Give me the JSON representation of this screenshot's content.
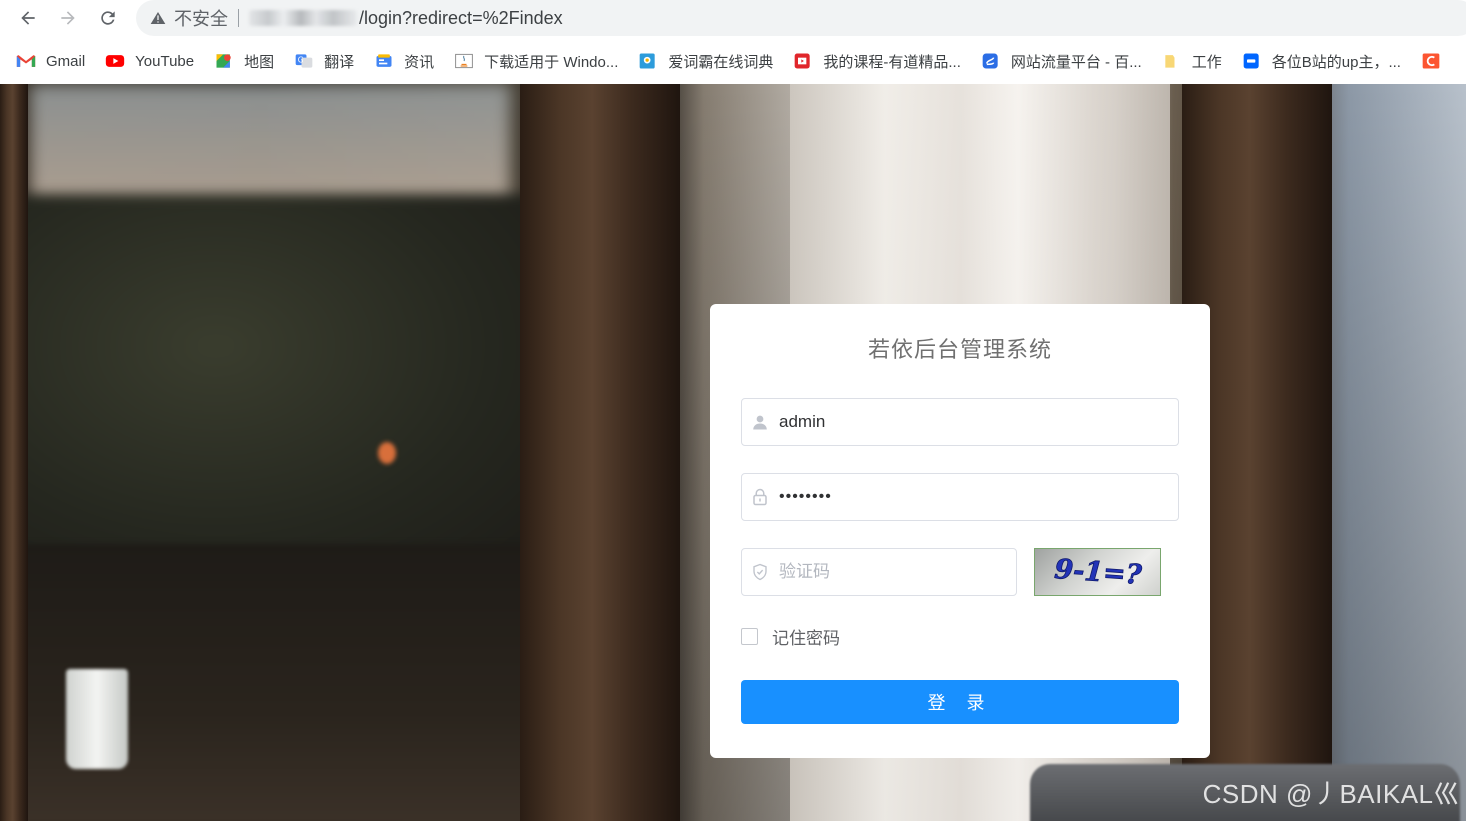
{
  "browser": {
    "security_text": "不安全",
    "url_path": "/login?redirect=%2Findex",
    "bookmarks": [
      {
        "label": "Gmail",
        "icon": "gmail-icon",
        "color": "#ea4335"
      },
      {
        "label": "YouTube",
        "icon": "youtube-icon",
        "color": "#ff0000"
      },
      {
        "label": "地图",
        "icon": "maps-icon",
        "color": "#34a853"
      },
      {
        "label": "翻译",
        "icon": "translate-icon",
        "color": "#4285f4"
      },
      {
        "label": "资讯",
        "icon": "news-icon",
        "color": "#4285f4"
      },
      {
        "label": "下载适用于 Windo...",
        "icon": "java-icon",
        "color": "#e76f00"
      },
      {
        "label": "爱词霸在线词典",
        "icon": "iciba-icon",
        "color": "#2d9cdb"
      },
      {
        "label": "我的课程-有道精品...",
        "icon": "youdao-icon",
        "color": "#e0262b"
      },
      {
        "label": "网站流量平台 - 百...",
        "icon": "baidu-tongji-icon",
        "color": "#2b6de5"
      },
      {
        "label": "工作",
        "icon": "folder-icon",
        "color": "#f8d775"
      },
      {
        "label": "各位B站的up主，...",
        "icon": "zhihu-icon",
        "color": "#0066ff"
      }
    ],
    "overflow_icon": "csdn-icon"
  },
  "login": {
    "title": "若依后台管理系统",
    "username_value": "admin",
    "password_mask": "••••••••",
    "captcha_placeholder": "验证码",
    "captcha_text": "9-1=?",
    "remember_label": "记住密码",
    "remember_checked": false,
    "submit_label": "登 录"
  },
  "watermark": "CSDN @丿BAIKAL巛",
  "colors": {
    "primary": "#1890ff",
    "title": "#707070",
    "border": "#dcdfe6"
  }
}
